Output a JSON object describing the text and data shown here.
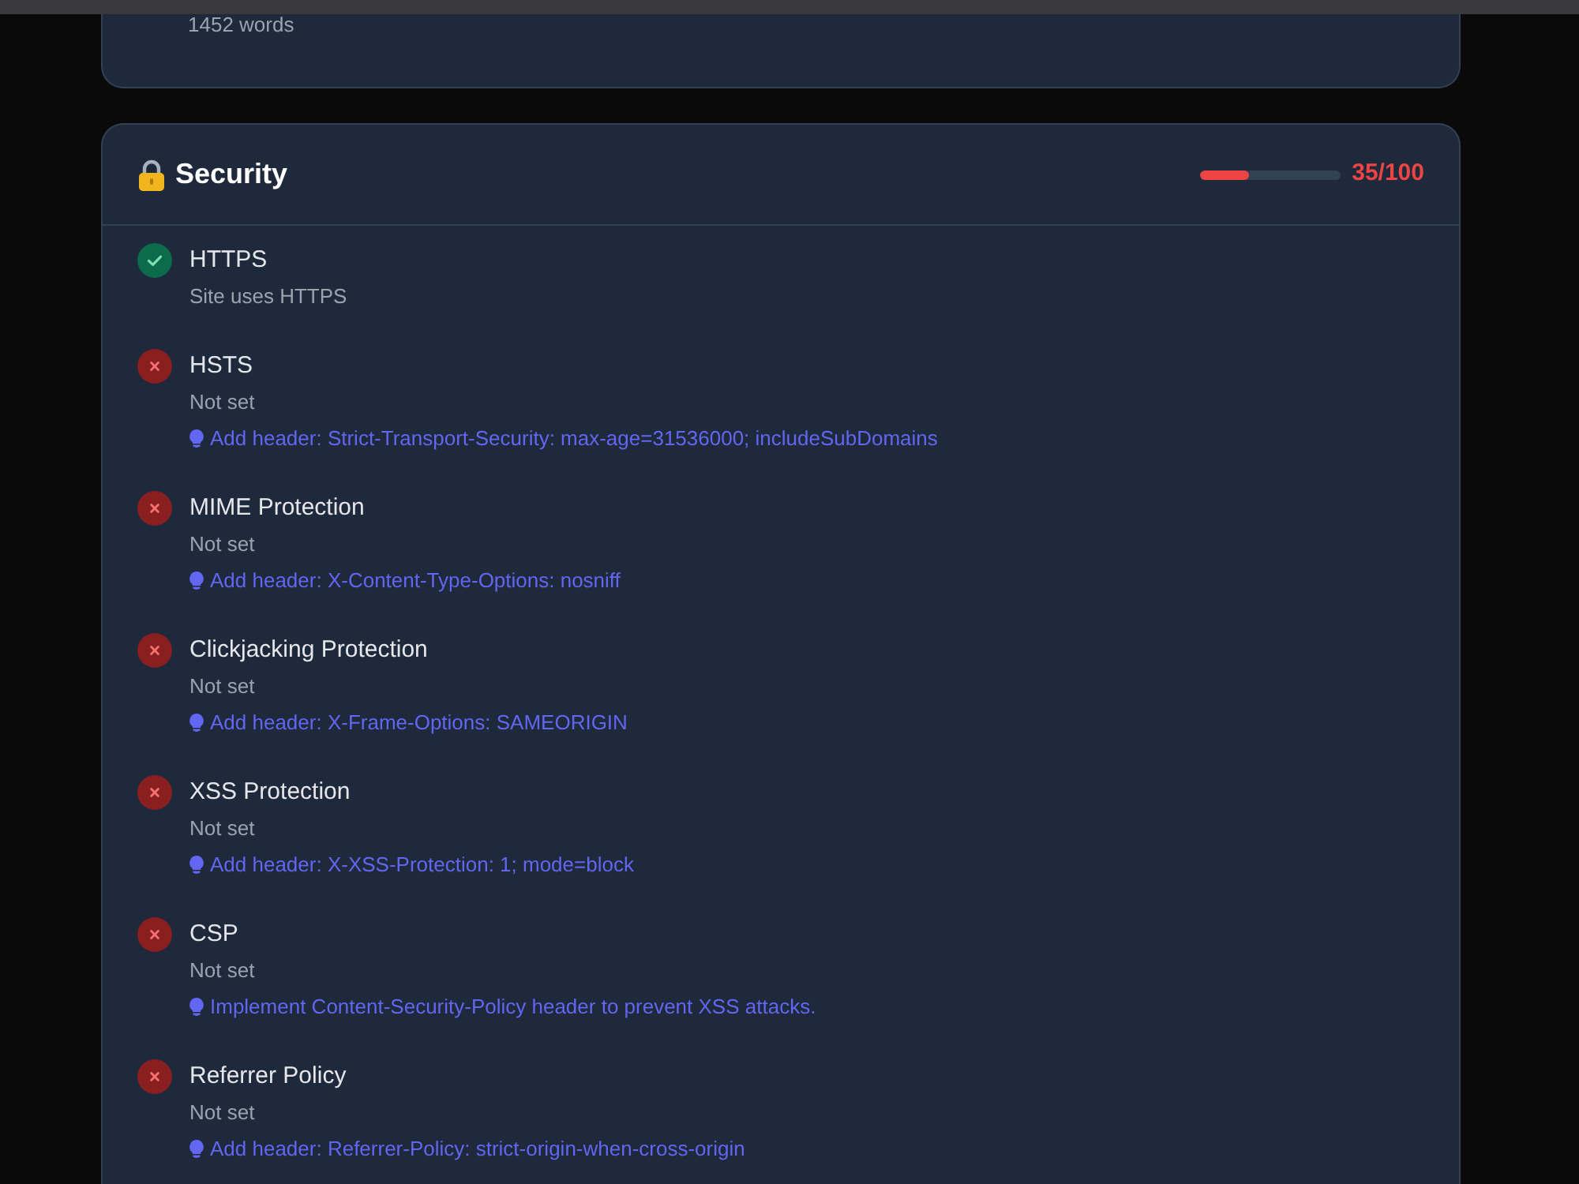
{
  "previous_card": {
    "word_count": "1452 words"
  },
  "security": {
    "title": "Security",
    "score": {
      "level": 0.35,
      "text": "35/100"
    },
    "checks": [
      {
        "name": "HTTPS",
        "passed": true,
        "detail": "Site uses HTTPS"
      },
      {
        "name": "HSTS",
        "passed": false,
        "detail": "Not set",
        "recommendation": "Add header: Strict-Transport-Security: max-age=31536000; includeSubDomains"
      },
      {
        "name": "MIME Protection",
        "passed": false,
        "detail": "Not set",
        "recommendation": "Add header: X-Content-Type-Options: nosniff"
      },
      {
        "name": "Clickjacking Protection",
        "passed": false,
        "detail": "Not set",
        "recommendation": "Add header: X-Frame-Options: SAMEORIGIN"
      },
      {
        "name": "XSS Protection",
        "passed": false,
        "detail": "Not set",
        "recommendation": "Add header: X-XSS-Protection: 1; mode=block"
      },
      {
        "name": "CSP",
        "passed": false,
        "detail": "Not set",
        "recommendation": "Implement Content-Security-Policy header to prevent XSS attacks."
      },
      {
        "name": "Referrer Policy",
        "passed": false,
        "detail": "Not set",
        "recommendation": "Add header: Referrer-Policy: strict-origin-when-cross-origin"
      }
    ]
  }
}
